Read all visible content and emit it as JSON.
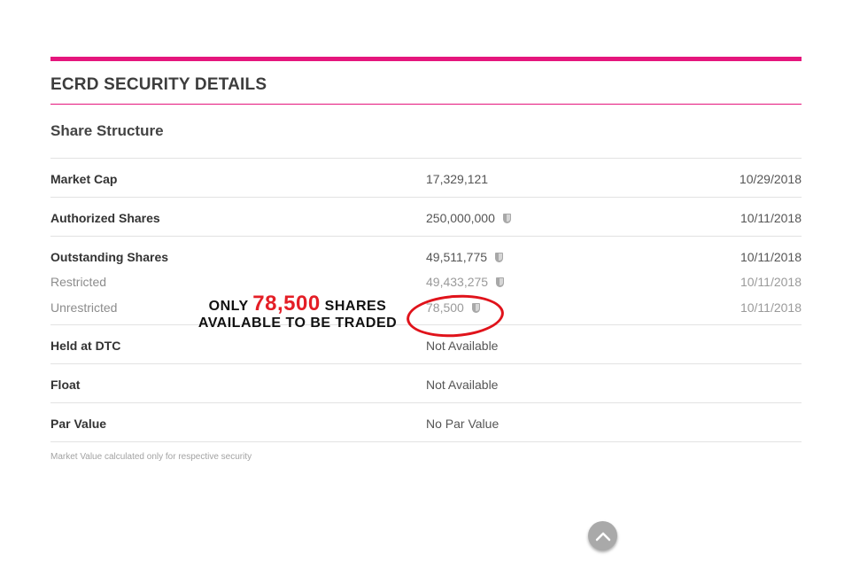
{
  "section_title": "ECRD SECURITY DETAILS",
  "subsection_title": "Share Structure",
  "rows": {
    "market_cap": {
      "label": "Market Cap",
      "value": "17,329,121",
      "date": "10/29/2018"
    },
    "authorized": {
      "label": "Authorized Shares",
      "value": "250,000,000",
      "date": "10/11/2018"
    },
    "outstanding": {
      "label": "Outstanding Shares",
      "value": "49,511,775",
      "date": "10/11/2018"
    },
    "restricted": {
      "label": "Restricted",
      "value": "49,433,275",
      "date": "10/11/2018"
    },
    "unrestricted": {
      "label": "Unrestricted",
      "value": "78,500",
      "date": "10/11/2018"
    },
    "held_dtc": {
      "label": "Held at DTC",
      "value": "Not Available"
    },
    "float": {
      "label": "Float",
      "value": "Not Available"
    },
    "par_value": {
      "label": "Par Value",
      "value": "No Par Value"
    }
  },
  "footnote": "Market Value calculated only for respective security",
  "annotation": {
    "prefix": "ONLY",
    "number": "78,500",
    "suffix": "SHARES",
    "line2": "AVAILABLE TO BE TRADED"
  },
  "icons": {
    "verified": "shield-icon",
    "scroll_top": "chevron-up-icon"
  },
  "colors": {
    "accent": "#e5167d",
    "annotation_red": "#e41e26"
  }
}
